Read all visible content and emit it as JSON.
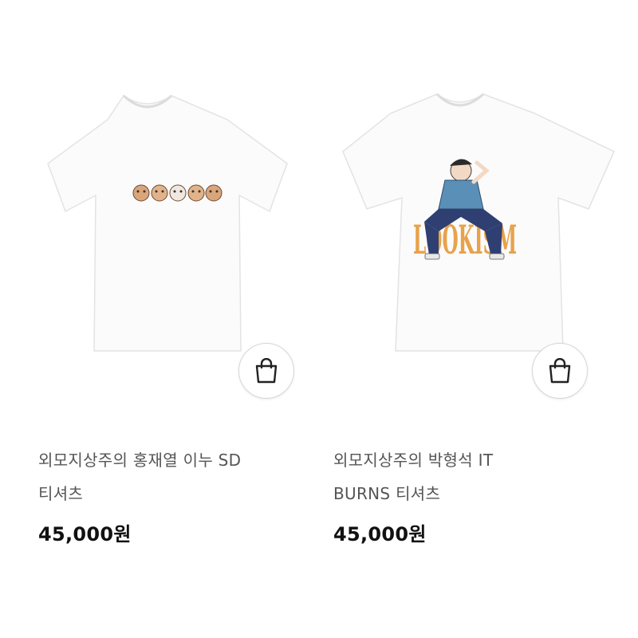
{
  "products": [
    {
      "name_line1": "외모지상주의 홍재열 이누 SD",
      "name_line2": "티셔츠",
      "price": "45,000원",
      "print_text": "",
      "cart_icon": "shopping-bag-icon"
    },
    {
      "name_line1": "외모지상주의 박형석 IT",
      "name_line2": "BURNS 티셔츠",
      "price": "45,000원",
      "print_text": "LOOKISM",
      "cart_icon": "shopping-bag-icon"
    }
  ],
  "colors": {
    "background": "#ffffff",
    "shirt": "#fbfbfb",
    "print_orange": "#e8a24a",
    "price_text": "#111111",
    "name_text": "#555555"
  }
}
